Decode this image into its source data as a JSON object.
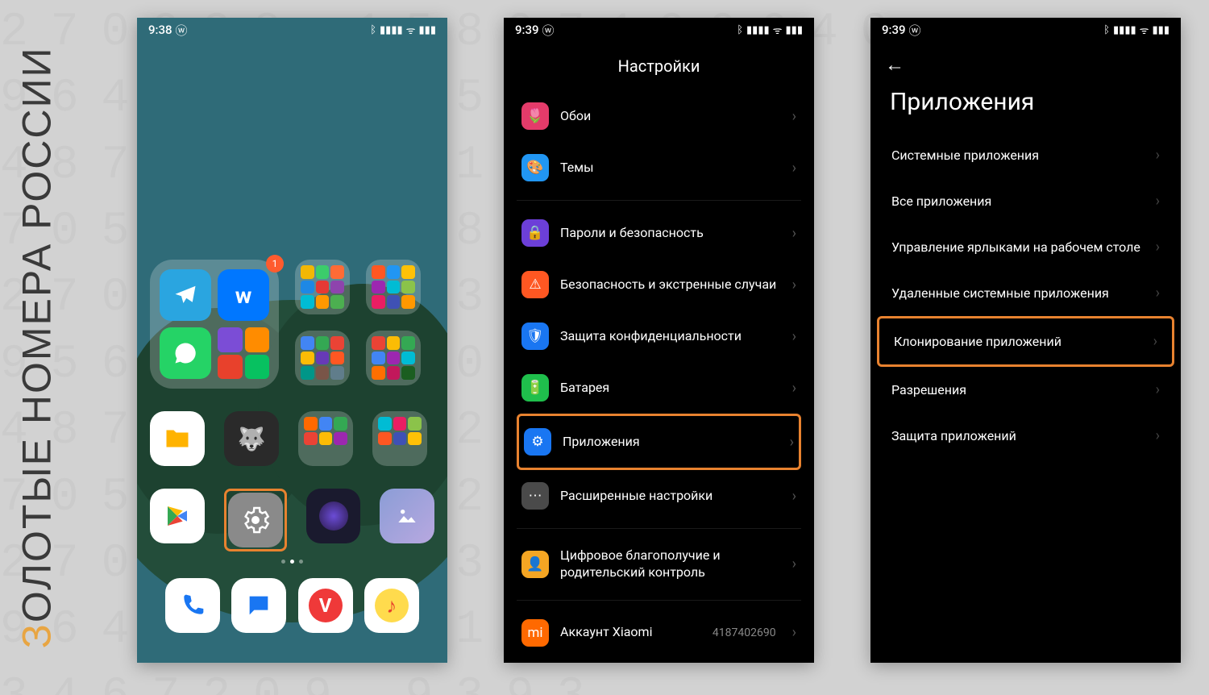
{
  "background_numbers": "270938 15807190640\n9640712 6540 2\n48723893 19330\n70582 70582 18\n27093270934 93\n95640956401012\n48723 487231 53\n7058270582 18\n27093270934 9\n9640956401012\n3467209 9393\n2093 956401 18\n2709327093 12\n9564095 401 64\n3467209 9393",
  "watermark": "ОЛОТЫЕ НОМЕРА РОССИИ",
  "watermark_accent": "З",
  "phone1": {
    "time": "9:38",
    "badge": "1",
    "apps": {
      "files": "📁",
      "wolf": "🐺",
      "folder3": "",
      "folder4": "",
      "play": "▶",
      "settings": "⚙",
      "camera": "◉",
      "gallery": "🖼",
      "phone": "📞",
      "chat": "💬",
      "vivaldi": "V",
      "music": "♪"
    }
  },
  "phone2": {
    "time": "9:39",
    "title": "Настройки",
    "items": [
      {
        "icon": "🌷",
        "label": "Обои",
        "color": "#e43b6a"
      },
      {
        "icon": "🎨",
        "label": "Темы",
        "color": "#2196f3"
      }
    ],
    "items2": [
      {
        "icon": "🔒",
        "label": "Пароли и безопасность",
        "color": "#6c3fd8"
      },
      {
        "icon": "⚠",
        "label": "Безопасность и экстренные случаи",
        "color": "#ff5722"
      },
      {
        "icon": "🛡",
        "label": "Защита конфиденциальности",
        "color": "#1976f2"
      },
      {
        "icon": "🔋",
        "label": "Батарея",
        "color": "#1fbf4c"
      },
      {
        "icon": "⚙",
        "label": "Приложения",
        "color": "#1976f2",
        "highlight": true
      },
      {
        "icon": "⋯",
        "label": "Расширенные настройки",
        "color": "#4a4a4a"
      }
    ],
    "items3": [
      {
        "icon": "👤",
        "label": "Цифровое благополучие и родительский контроль",
        "color": "#f5a623"
      }
    ],
    "items4": [
      {
        "icon": "mi",
        "label": "Аккаунт Xiaomi",
        "color": "#ff6900",
        "sub": "4187402690"
      }
    ]
  },
  "phone3": {
    "time": "9:39",
    "title": "Приложения",
    "items": [
      {
        "label": "Системные приложения"
      },
      {
        "label": "Все приложения"
      },
      {
        "label": "Управление ярлыками на рабочем столе"
      },
      {
        "label": "Удаленные системные приложения"
      },
      {
        "label": "Клонирование приложений",
        "highlight": true
      },
      {
        "label": "Разрешения"
      },
      {
        "label": "Защита приложений"
      }
    ]
  }
}
